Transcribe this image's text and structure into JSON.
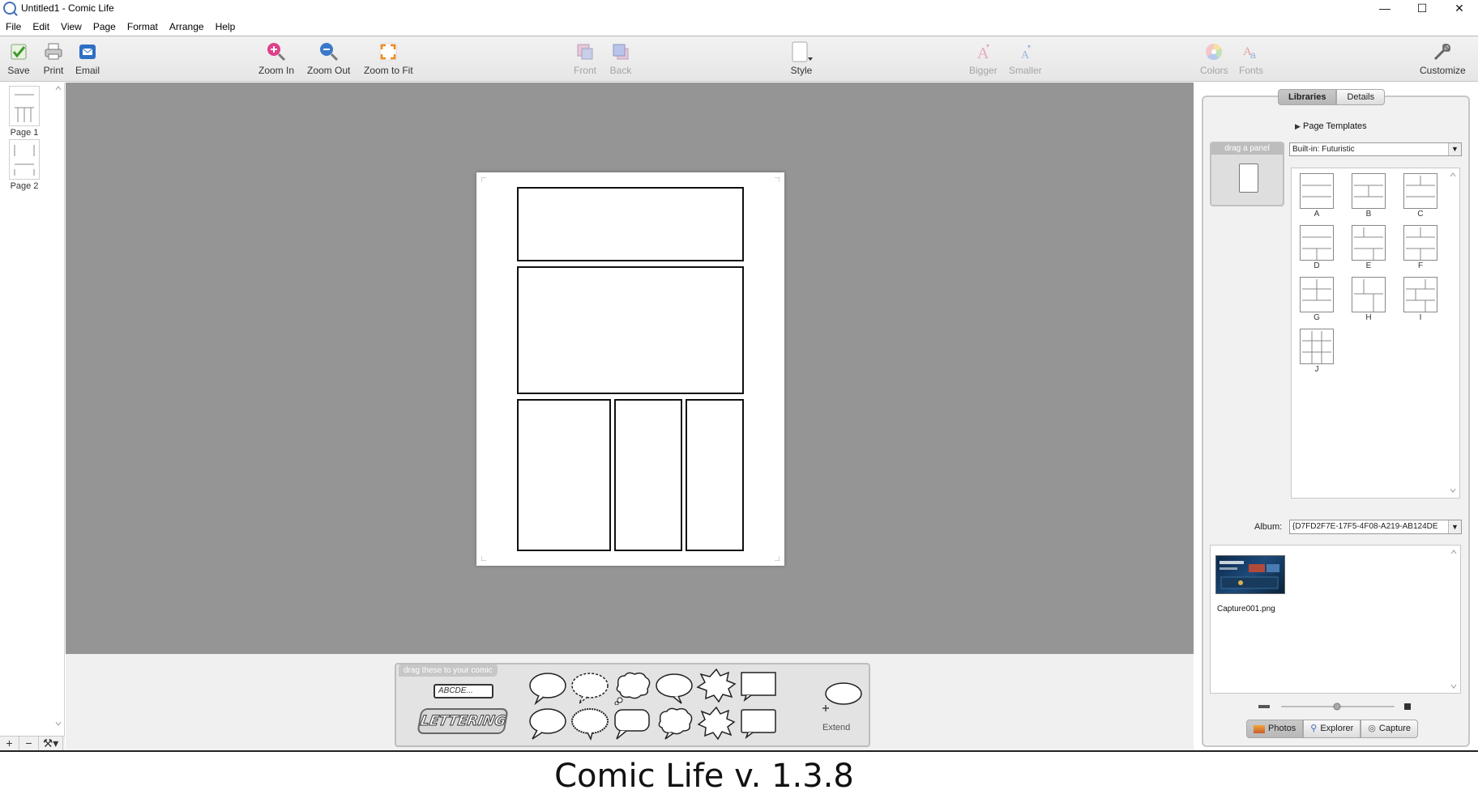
{
  "window": {
    "title": "Untitled1 - Comic Life",
    "controls": {
      "minimize": "—",
      "maximize": "☐",
      "close": "✕"
    }
  },
  "menu": [
    "File",
    "Edit",
    "View",
    "Page",
    "Format",
    "Arrange",
    "Help"
  ],
  "toolbar": {
    "save": "Save",
    "print": "Print",
    "email": "Email",
    "zoom_in": "Zoom In",
    "zoom_out": "Zoom Out",
    "zoom_fit": "Zoom to Fit",
    "front": "Front",
    "back": "Back",
    "style": "Style",
    "bigger": "Bigger",
    "smaller": "Smaller",
    "colors": "Colors",
    "fonts": "Fonts",
    "customize": "Customize"
  },
  "pages": [
    {
      "label": "Page 1"
    },
    {
      "label": "Page 2"
    }
  ],
  "page_tools": {
    "add": "+",
    "remove": "−",
    "settings": "⚒▾"
  },
  "balloon_tray": {
    "title": "drag these to your comic",
    "caption_text": "ABCDE...",
    "lettering": "LETTERING",
    "extend": "Extend"
  },
  "library": {
    "tabs": [
      "Libraries",
      "Details"
    ],
    "active_tab": "Libraries",
    "drag_panel_label": "drag a panel",
    "templates_header": "Page Templates",
    "templates_selected": "Built-in: Futuristic",
    "templates": [
      "A",
      "B",
      "C",
      "D",
      "E",
      "F",
      "G",
      "H",
      "I",
      "J"
    ],
    "album_label": "Album:",
    "album_selected": "{D7FD2F7E-17F5-4F08-A219-AB124DE",
    "photos": [
      {
        "name": "Capture001.png"
      }
    ],
    "photo_tabs": [
      "Photos",
      "Explorer",
      "Capture"
    ],
    "active_photo_tab": "Photos"
  },
  "caption": "Comic Life v. 1.3.8",
  "colors": {
    "canvas": "#959595",
    "panel_border": "#111111",
    "zoom_in_icon": "#e0408a",
    "zoom_out_icon": "#3a78c8",
    "zoom_fit_icon": "#f08a20"
  }
}
